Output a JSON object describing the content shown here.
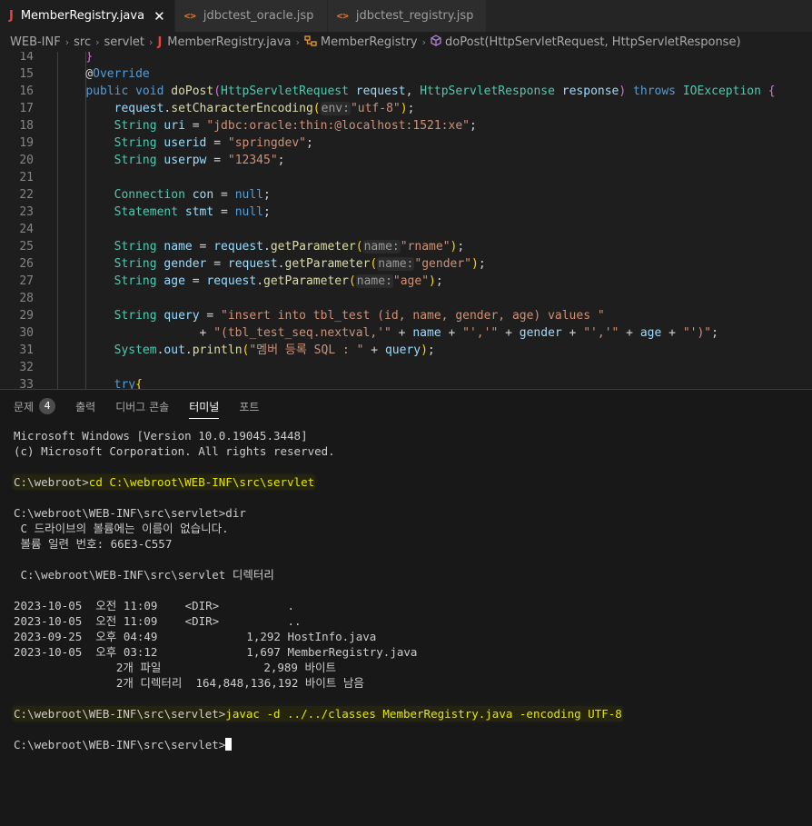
{
  "tabs": [
    {
      "label": "MemberRegistry.java",
      "icon": "J",
      "active": true
    },
    {
      "label": "jdbctest_oracle.jsp",
      "icon": "<>",
      "active": false
    },
    {
      "label": "jdbctest_registry.jsp",
      "icon": "<>",
      "active": false
    }
  ],
  "tab_close": "✕",
  "breadcrumb": {
    "items": [
      "WEB-INF",
      "src",
      "servlet",
      "MemberRegistry.java",
      "MemberRegistry",
      "doPost(HttpServletRequest, HttpServletResponse)"
    ],
    "sep": "›"
  },
  "code": {
    "lines": [
      {
        "n": "14",
        "parts": [
          {
            "t": "    ",
            "c": "pl"
          },
          {
            "t": "}",
            "c": "br"
          }
        ]
      },
      {
        "n": "15",
        "parts": [
          {
            "t": "    @",
            "c": "pl"
          },
          {
            "t": "Override",
            "c": "an"
          }
        ]
      },
      {
        "n": "16",
        "parts": [
          {
            "t": "    ",
            "c": "pl"
          },
          {
            "t": "public",
            "c": "kw"
          },
          {
            "t": " ",
            "c": "pl"
          },
          {
            "t": "void",
            "c": "kw"
          },
          {
            "t": " ",
            "c": "pl"
          },
          {
            "t": "doPost",
            "c": "fn"
          },
          {
            "t": "(",
            "c": "br"
          },
          {
            "t": "HttpServletRequest",
            "c": "ty"
          },
          {
            "t": " ",
            "c": "pl"
          },
          {
            "t": "request",
            "c": "vr"
          },
          {
            "t": ", ",
            "c": "pl"
          },
          {
            "t": "HttpServletResponse",
            "c": "ty"
          },
          {
            "t": " ",
            "c": "pl"
          },
          {
            "t": "response",
            "c": "vr"
          },
          {
            "t": ")",
            "c": "br"
          },
          {
            "t": " ",
            "c": "pl"
          },
          {
            "t": "throws",
            "c": "kw"
          },
          {
            "t": " ",
            "c": "pl"
          },
          {
            "t": "IOException",
            "c": "ty"
          },
          {
            "t": " ",
            "c": "pl"
          },
          {
            "t": "{",
            "c": "br"
          }
        ]
      },
      {
        "n": "17",
        "parts": [
          {
            "t": "        ",
            "c": "pl"
          },
          {
            "t": "request",
            "c": "vr"
          },
          {
            "t": ".",
            "c": "pl"
          },
          {
            "t": "setCharacterEncoding",
            "c": "fn"
          },
          {
            "t": "(",
            "c": "by"
          },
          {
            "t": "env:",
            "c": "hint"
          },
          {
            "t": "\"utf-8\"",
            "c": "st"
          },
          {
            "t": ")",
            "c": "by"
          },
          {
            "t": ";",
            "c": "pl"
          }
        ]
      },
      {
        "n": "18",
        "parts": [
          {
            "t": "        ",
            "c": "pl"
          },
          {
            "t": "String",
            "c": "ty"
          },
          {
            "t": " ",
            "c": "pl"
          },
          {
            "t": "uri",
            "c": "vr"
          },
          {
            "t": " = ",
            "c": "pl"
          },
          {
            "t": "\"jdbc:oracle:thin:@localhost:1521:xe\"",
            "c": "st"
          },
          {
            "t": ";",
            "c": "pl"
          }
        ]
      },
      {
        "n": "19",
        "parts": [
          {
            "t": "        ",
            "c": "pl"
          },
          {
            "t": "String",
            "c": "ty"
          },
          {
            "t": " ",
            "c": "pl"
          },
          {
            "t": "userid",
            "c": "vr"
          },
          {
            "t": " = ",
            "c": "pl"
          },
          {
            "t": "\"springdev\"",
            "c": "st"
          },
          {
            "t": ";",
            "c": "pl"
          }
        ]
      },
      {
        "n": "20",
        "parts": [
          {
            "t": "        ",
            "c": "pl"
          },
          {
            "t": "String",
            "c": "ty"
          },
          {
            "t": " ",
            "c": "pl"
          },
          {
            "t": "userpw",
            "c": "vr"
          },
          {
            "t": " = ",
            "c": "pl"
          },
          {
            "t": "\"12345\"",
            "c": "st"
          },
          {
            "t": ";",
            "c": "pl"
          }
        ]
      },
      {
        "n": "21",
        "parts": []
      },
      {
        "n": "22",
        "parts": [
          {
            "t": "        ",
            "c": "pl"
          },
          {
            "t": "Connection",
            "c": "ty"
          },
          {
            "t": " ",
            "c": "pl"
          },
          {
            "t": "con",
            "c": "vr"
          },
          {
            "t": " = ",
            "c": "pl"
          },
          {
            "t": "null",
            "c": "kw"
          },
          {
            "t": ";",
            "c": "pl"
          }
        ]
      },
      {
        "n": "23",
        "parts": [
          {
            "t": "        ",
            "c": "pl"
          },
          {
            "t": "Statement",
            "c": "ty"
          },
          {
            "t": " ",
            "c": "pl"
          },
          {
            "t": "stmt",
            "c": "vr"
          },
          {
            "t": " = ",
            "c": "pl"
          },
          {
            "t": "null",
            "c": "kw"
          },
          {
            "t": ";",
            "c": "pl"
          }
        ]
      },
      {
        "n": "24",
        "parts": []
      },
      {
        "n": "25",
        "parts": [
          {
            "t": "        ",
            "c": "pl"
          },
          {
            "t": "String",
            "c": "ty"
          },
          {
            "t": " ",
            "c": "pl"
          },
          {
            "t": "name",
            "c": "vr"
          },
          {
            "t": " = ",
            "c": "pl"
          },
          {
            "t": "request",
            "c": "vr"
          },
          {
            "t": ".",
            "c": "pl"
          },
          {
            "t": "getParameter",
            "c": "fn"
          },
          {
            "t": "(",
            "c": "by"
          },
          {
            "t": "name:",
            "c": "hint"
          },
          {
            "t": "\"rname\"",
            "c": "st"
          },
          {
            "t": ")",
            "c": "by"
          },
          {
            "t": ";",
            "c": "pl"
          }
        ]
      },
      {
        "n": "26",
        "parts": [
          {
            "t": "        ",
            "c": "pl"
          },
          {
            "t": "String",
            "c": "ty"
          },
          {
            "t": " ",
            "c": "pl"
          },
          {
            "t": "gender",
            "c": "vr"
          },
          {
            "t": " = ",
            "c": "pl"
          },
          {
            "t": "request",
            "c": "vr"
          },
          {
            "t": ".",
            "c": "pl"
          },
          {
            "t": "getParameter",
            "c": "fn"
          },
          {
            "t": "(",
            "c": "by"
          },
          {
            "t": "name:",
            "c": "hint"
          },
          {
            "t": "\"gender\"",
            "c": "st"
          },
          {
            "t": ")",
            "c": "by"
          },
          {
            "t": ";",
            "c": "pl"
          }
        ]
      },
      {
        "n": "27",
        "parts": [
          {
            "t": "        ",
            "c": "pl"
          },
          {
            "t": "String",
            "c": "ty"
          },
          {
            "t": " ",
            "c": "pl"
          },
          {
            "t": "age",
            "c": "vr"
          },
          {
            "t": " = ",
            "c": "pl"
          },
          {
            "t": "request",
            "c": "vr"
          },
          {
            "t": ".",
            "c": "pl"
          },
          {
            "t": "getParameter",
            "c": "fn"
          },
          {
            "t": "(",
            "c": "by"
          },
          {
            "t": "name:",
            "c": "hint"
          },
          {
            "t": "\"age\"",
            "c": "st"
          },
          {
            "t": ")",
            "c": "by"
          },
          {
            "t": ";",
            "c": "pl"
          }
        ]
      },
      {
        "n": "28",
        "parts": []
      },
      {
        "n": "29",
        "parts": [
          {
            "t": "        ",
            "c": "pl"
          },
          {
            "t": "String",
            "c": "ty"
          },
          {
            "t": " ",
            "c": "pl"
          },
          {
            "t": "query",
            "c": "vr"
          },
          {
            "t": " = ",
            "c": "pl"
          },
          {
            "t": "\"insert into tbl_test (id, name, gender, age) values \"",
            "c": "st"
          }
        ]
      },
      {
        "n": "30",
        "parts": [
          {
            "t": "                    + ",
            "c": "pl"
          },
          {
            "t": "\"(tbl_test_seq.nextval,'\"",
            "c": "st"
          },
          {
            "t": " + ",
            "c": "pl"
          },
          {
            "t": "name",
            "c": "vr"
          },
          {
            "t": " + ",
            "c": "pl"
          },
          {
            "t": "\"','\"",
            "c": "st"
          },
          {
            "t": " + ",
            "c": "pl"
          },
          {
            "t": "gender",
            "c": "vr"
          },
          {
            "t": " + ",
            "c": "pl"
          },
          {
            "t": "\"','\"",
            "c": "st"
          },
          {
            "t": " + ",
            "c": "pl"
          },
          {
            "t": "age",
            "c": "vr"
          },
          {
            "t": " + ",
            "c": "pl"
          },
          {
            "t": "\"')\"",
            "c": "st"
          },
          {
            "t": ";",
            "c": "pl"
          }
        ]
      },
      {
        "n": "31",
        "parts": [
          {
            "t": "        ",
            "c": "pl"
          },
          {
            "t": "System",
            "c": "ty"
          },
          {
            "t": ".",
            "c": "pl"
          },
          {
            "t": "out",
            "c": "vr"
          },
          {
            "t": ".",
            "c": "pl"
          },
          {
            "t": "println",
            "c": "fn"
          },
          {
            "t": "(",
            "c": "by"
          },
          {
            "t": "\"멤버 등록 SQL : \"",
            "c": "st"
          },
          {
            "t": " + ",
            "c": "pl"
          },
          {
            "t": "query",
            "c": "vr"
          },
          {
            "t": ")",
            "c": "by"
          },
          {
            "t": ";",
            "c": "pl"
          }
        ]
      },
      {
        "n": "32",
        "parts": []
      },
      {
        "n": "33",
        "parts": [
          {
            "t": "        ",
            "c": "pl"
          },
          {
            "t": "try",
            "c": "kw"
          },
          {
            "t": "{",
            "c": "by"
          }
        ]
      }
    ]
  },
  "panel": {
    "tabs": [
      {
        "label": "문제",
        "badge": "4",
        "active": false
      },
      {
        "label": "출력",
        "active": false
      },
      {
        "label": "디버그 콘솔",
        "active": false
      },
      {
        "label": "터미널",
        "active": true
      },
      {
        "label": "포트",
        "active": false
      }
    ]
  },
  "terminal": {
    "lines": [
      {
        "t": "Microsoft Windows [Version 10.0.19045.3448]"
      },
      {
        "t": "(c) Microsoft Corporation. All rights reserved."
      },
      {
        "t": ""
      },
      {
        "t": "C:\\webroot>",
        "cmd": "cd C:\\webroot\\WEB-INF\\src\\servlet"
      },
      {
        "t": ""
      },
      {
        "t": "C:\\webroot\\WEB-INF\\src\\servlet>dir"
      },
      {
        "t": " C 드라이브의 볼륨에는 이름이 없습니다."
      },
      {
        "t": " 볼륨 일련 번호: 66E3-C557"
      },
      {
        "t": ""
      },
      {
        "t": " C:\\webroot\\WEB-INF\\src\\servlet 디렉터리"
      },
      {
        "t": ""
      },
      {
        "t": "2023-10-05  오전 11:09    <DIR>          ."
      },
      {
        "t": "2023-10-05  오전 11:09    <DIR>          .."
      },
      {
        "t": "2023-09-25  오후 04:49             1,292 HostInfo.java"
      },
      {
        "t": "2023-10-05  오후 03:12             1,697 MemberRegistry.java"
      },
      {
        "t": "               2개 파일               2,989 바이트"
      },
      {
        "t": "               2개 디렉터리  164,848,136,192 바이트 남음"
      },
      {
        "t": ""
      },
      {
        "t": "C:\\webroot\\WEB-INF\\src\\servlet>",
        "cmd": "javac -d ../../classes MemberRegistry.java -encoding UTF-8"
      },
      {
        "t": ""
      },
      {
        "t": "C:\\webroot\\WEB-INF\\src\\servlet>",
        "cursor": true
      }
    ]
  },
  "colors": {
    "editor_bg": "#1e1e1e",
    "panel_bg": "#181818",
    "tab_bar_bg": "#252526",
    "command_highlight": "#e6e600"
  },
  "icons": {
    "java": "java-file-icon",
    "jsp": "jsp-file-icon",
    "class": "class-symbol-icon",
    "method": "method-symbol-icon"
  }
}
